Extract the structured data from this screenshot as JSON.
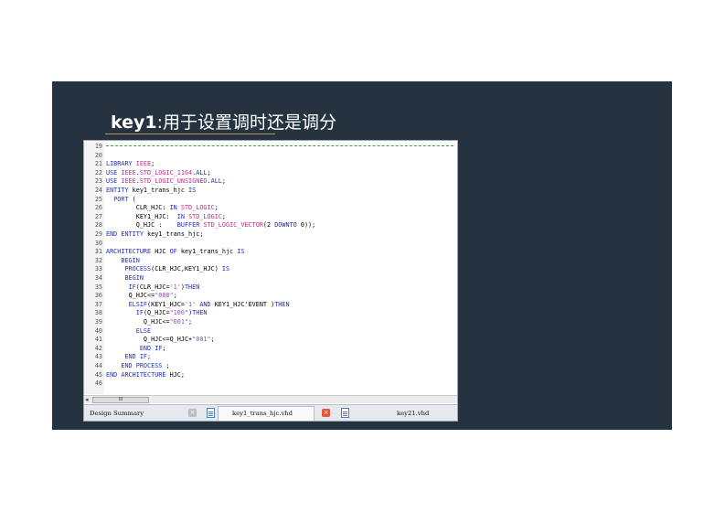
{
  "slide": {
    "title_keyword": "key1",
    "title_rest": ":用于设置调时还是调分"
  },
  "editor": {
    "lines": [
      {
        "n": "19",
        "t": ""
      },
      {
        "n": "20",
        "t": ""
      },
      {
        "n": "21",
        "t": "LIBRARY IEEE;"
      },
      {
        "n": "22",
        "t": "USE IEEE.STD_LOGIC_1164.ALL;"
      },
      {
        "n": "23",
        "t": "USE IEEE.STD_LOGIC_UNSIGNED.ALL;"
      },
      {
        "n": "24",
        "t": "ENTITY key1_trans_hjc IS"
      },
      {
        "n": "25",
        "t": "  PORT ("
      },
      {
        "n": "26",
        "t": "        CLR_HJC: IN STD_LOGIC;"
      },
      {
        "n": "27",
        "t": "        KEY1_HJC:  IN STD_LOGIC;"
      },
      {
        "n": "28",
        "t": "        Q_HJC :    BUFFER STD_LOGIC_VECTOR(2 DOWNTO 0));"
      },
      {
        "n": "29",
        "t": "END ENTITY key1_trans_hjc;"
      },
      {
        "n": "30",
        "t": ""
      },
      {
        "n": "31",
        "t": "ARCHITECTURE HJC OF key1_trans_hjc IS"
      },
      {
        "n": "32",
        "t": "    BEGIN"
      },
      {
        "n": "33",
        "t": "     PROCESS(CLR_HJC,KEY1_HJC) IS"
      },
      {
        "n": "34",
        "t": "     BEGIN"
      },
      {
        "n": "35",
        "t": "      IF(CLR_HJC='1')THEN"
      },
      {
        "n": "36",
        "t": "      Q_HJC<=\"000\";"
      },
      {
        "n": "37",
        "t": "      ELSIF(KEY1_HJC='1' AND KEY1_HJC'EVENT )THEN"
      },
      {
        "n": "38",
        "t": "        IF(Q_HJC=\"100\")THEN"
      },
      {
        "n": "39",
        "t": "          Q_HJC<=\"001\";"
      },
      {
        "n": "40",
        "t": "        ELSE"
      },
      {
        "n": "41",
        "t": "          Q_HJC<=Q_HJC+\"001\";"
      },
      {
        "n": "42",
        "t": "         END IF;"
      },
      {
        "n": "43",
        "t": "     END IF;"
      },
      {
        "n": "44",
        "t": "    END PROCESS ;"
      },
      {
        "n": "45",
        "t": "END ARCHITECTURE HJC;"
      },
      {
        "n": "46",
        "t": ""
      }
    ],
    "scroll_thumb_label": "III",
    "tabs": {
      "design_summary": "Design Summary",
      "key1_file": "key1_trans_hjc.vhd",
      "key2_file": "key21.vhd"
    }
  },
  "colors": {
    "slide_bg": "#253341",
    "title_underline": "#b6913f",
    "keyword_blue": "#1f2dcc",
    "string_purple": "#8a5aa8",
    "comment_dash_green": "#3ba33b"
  }
}
